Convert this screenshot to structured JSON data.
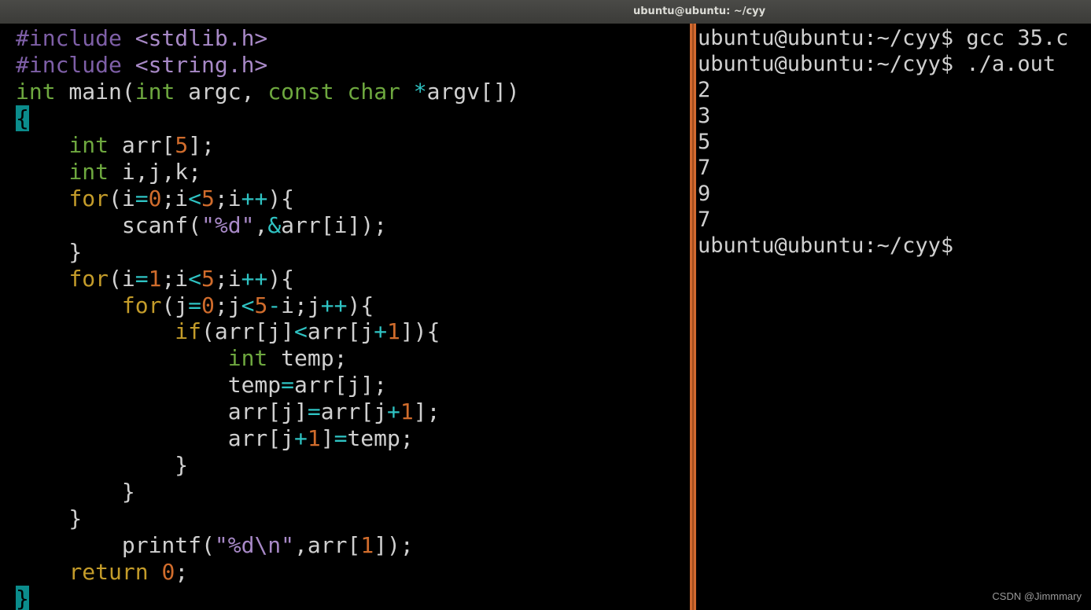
{
  "window": {
    "title": "ubuntu@ubuntu: ~/cyy"
  },
  "editor": {
    "lines": [
      [
        [
          "pp",
          "#include "
        ],
        [
          "str",
          "<stdlib.h>"
        ]
      ],
      [
        [
          "pp",
          "#include "
        ],
        [
          "str",
          "<string.h>"
        ]
      ],
      [
        [
          "ty",
          "int"
        ],
        [
          "id",
          " main("
        ],
        [
          "ty",
          "int"
        ],
        [
          "id",
          " argc, "
        ],
        [
          "ty",
          "const"
        ],
        [
          "id",
          " "
        ],
        [
          "ty",
          "char"
        ],
        [
          "id",
          " "
        ],
        [
          "op",
          "*"
        ],
        [
          "id",
          "argv[])"
        ]
      ],
      [
        [
          "cursor",
          "{"
        ]
      ],
      [
        [
          "id",
          "    "
        ],
        [
          "ty",
          "int"
        ],
        [
          "id",
          " arr["
        ],
        [
          "num",
          "5"
        ],
        [
          "id",
          "];"
        ]
      ],
      [
        [
          "id",
          "    "
        ],
        [
          "ty",
          "int"
        ],
        [
          "id",
          " i,j,k;"
        ]
      ],
      [
        [
          "id",
          "    "
        ],
        [
          "kw",
          "for"
        ],
        [
          "id",
          "(i"
        ],
        [
          "op",
          "="
        ],
        [
          "num",
          "0"
        ],
        [
          "id",
          ";i"
        ],
        [
          "op",
          "<"
        ],
        [
          "num",
          "5"
        ],
        [
          "id",
          ";i"
        ],
        [
          "op",
          "++"
        ],
        [
          "id",
          "){"
        ]
      ],
      [
        [
          "id",
          "        scanf("
        ],
        [
          "str",
          "\"%d\""
        ],
        [
          "id",
          ","
        ],
        [
          "op",
          "&"
        ],
        [
          "id",
          "arr[i]);"
        ]
      ],
      [
        [
          "id",
          "    }"
        ]
      ],
      [
        [
          "id",
          "    "
        ],
        [
          "kw",
          "for"
        ],
        [
          "id",
          "(i"
        ],
        [
          "op",
          "="
        ],
        [
          "num",
          "1"
        ],
        [
          "id",
          ";i"
        ],
        [
          "op",
          "<"
        ],
        [
          "num",
          "5"
        ],
        [
          "id",
          ";i"
        ],
        [
          "op",
          "++"
        ],
        [
          "id",
          "){"
        ]
      ],
      [
        [
          "id",
          "        "
        ],
        [
          "kw",
          "for"
        ],
        [
          "id",
          "(j"
        ],
        [
          "op",
          "="
        ],
        [
          "num",
          "0"
        ],
        [
          "id",
          ";j"
        ],
        [
          "op",
          "<"
        ],
        [
          "num",
          "5"
        ],
        [
          "op",
          "-"
        ],
        [
          "id",
          "i;j"
        ],
        [
          "op",
          "++"
        ],
        [
          "id",
          "){"
        ]
      ],
      [
        [
          "id",
          "            "
        ],
        [
          "kw",
          "if"
        ],
        [
          "id",
          "(arr[j]"
        ],
        [
          "op",
          "<"
        ],
        [
          "id",
          "arr[j"
        ],
        [
          "op",
          "+"
        ],
        [
          "num",
          "1"
        ],
        [
          "id",
          "]){"
        ]
      ],
      [
        [
          "id",
          "                "
        ],
        [
          "ty",
          "int"
        ],
        [
          "id",
          " temp;"
        ]
      ],
      [
        [
          "id",
          "                temp"
        ],
        [
          "op",
          "="
        ],
        [
          "id",
          "arr[j];"
        ]
      ],
      [
        [
          "id",
          "                arr[j]"
        ],
        [
          "op",
          "="
        ],
        [
          "id",
          "arr[j"
        ],
        [
          "op",
          "+"
        ],
        [
          "num",
          "1"
        ],
        [
          "id",
          "];"
        ]
      ],
      [
        [
          "id",
          "                arr[j"
        ],
        [
          "op",
          "+"
        ],
        [
          "num",
          "1"
        ],
        [
          "id",
          "]"
        ],
        [
          "op",
          "="
        ],
        [
          "id",
          "temp;"
        ]
      ],
      [
        [
          "id",
          "            }"
        ]
      ],
      [
        [
          "id",
          "        }"
        ]
      ],
      [
        [
          "id",
          "    }"
        ]
      ],
      [
        [
          "id",
          "        printf("
        ],
        [
          "str",
          "\"%d\\n\""
        ],
        [
          "id",
          ",arr["
        ],
        [
          "num",
          "1"
        ],
        [
          "id",
          "]);"
        ]
      ],
      [
        [
          "id",
          "    "
        ],
        [
          "kw",
          "return"
        ],
        [
          "id",
          " "
        ],
        [
          "num",
          "0"
        ],
        [
          "id",
          ";"
        ]
      ],
      [
        [
          "cursor",
          "}"
        ]
      ]
    ]
  },
  "terminal": {
    "lines": [
      "ubuntu@ubuntu:~/cyy$ gcc 35.c",
      "ubuntu@ubuntu:~/cyy$ ./a.out",
      "2",
      "3",
      "5",
      "7",
      "9",
      "7",
      "ubuntu@ubuntu:~/cyy$"
    ]
  },
  "watermark": "CSDN @Jimmmary",
  "colors": {
    "preprocessor": "#7e5fa7",
    "string": "#a889c7",
    "type": "#6ea83f",
    "keyword": "#c49c2a",
    "number": "#d06c2c",
    "operator": "#2fc3c3",
    "text": "#d0d0d0",
    "divider": "#d2692f",
    "cursor": "#0b8c8c"
  }
}
